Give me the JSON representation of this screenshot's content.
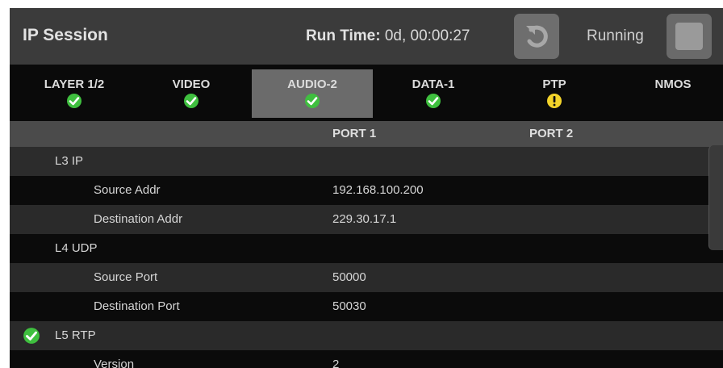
{
  "header": {
    "title": "IP Session",
    "run_time_label": "Run Time:",
    "run_time_value": "0d, 00:00:27",
    "running_label": "Running"
  },
  "tabs": [
    {
      "label": "LAYER 1/2",
      "status": "ok"
    },
    {
      "label": "VIDEO",
      "status": "ok"
    },
    {
      "label": "AUDIO-2",
      "status": "ok",
      "active": true
    },
    {
      "label": "DATA-1",
      "status": "ok"
    },
    {
      "label": "PTP",
      "status": "warning"
    },
    {
      "label": "NMOS"
    }
  ],
  "table": {
    "columns": [
      "PORT 1",
      "PORT 2"
    ],
    "rows": [
      {
        "name": "L3 IP",
        "value": ""
      },
      {
        "name": "Source Addr",
        "value": "192.168.100.200"
      },
      {
        "name": "Destination Addr",
        "value": "229.30.17.1"
      },
      {
        "name": "L4 UDP",
        "value": ""
      },
      {
        "name": "Source Port",
        "value": "50000"
      },
      {
        "name": "Destination Port",
        "value": "50030"
      },
      {
        "name": "L5 RTP",
        "value": ""
      },
      {
        "name": "Version",
        "value": "2"
      }
    ]
  },
  "colors": {
    "ok": "#3fbf3f",
    "warning": "#f2d32a",
    "active_tab": "#6b6b6b",
    "header_bg": "#3b3b3b"
  },
  "icons": {
    "status_ok": "check-circle-icon",
    "status_warning": "exclamation-circle-icon",
    "reset": "reset-icon",
    "stop": "stop-square-icon"
  }
}
